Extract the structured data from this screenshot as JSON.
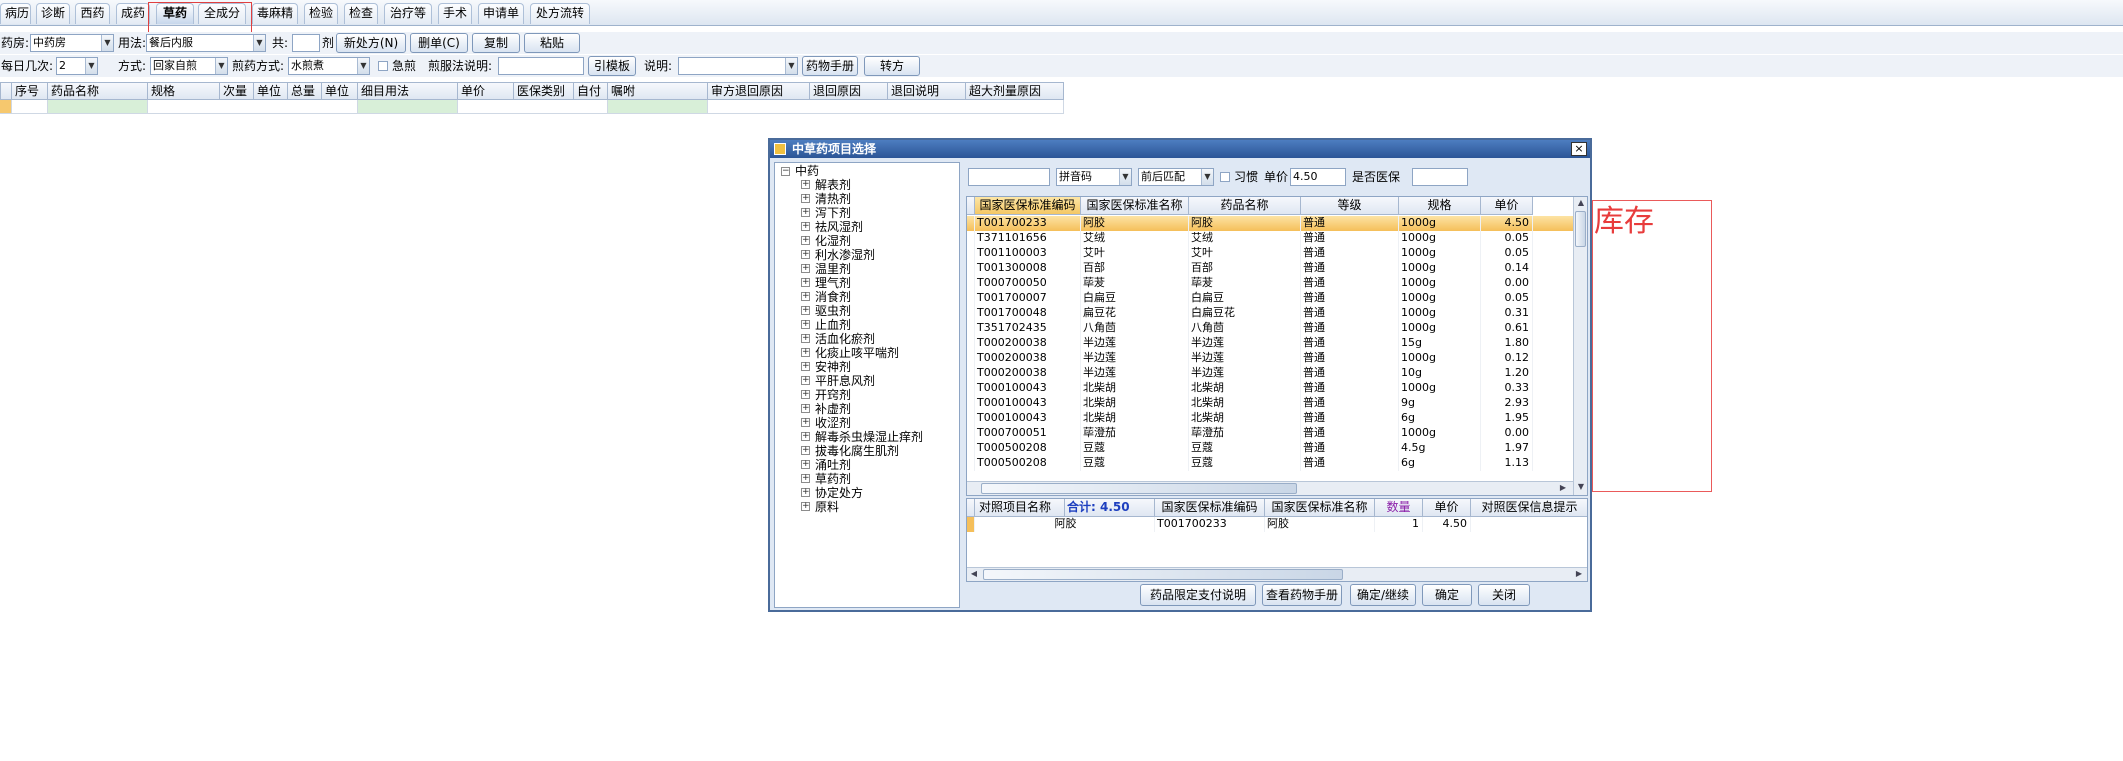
{
  "tabs": [
    {
      "label": "病历"
    },
    {
      "label": "诊断"
    },
    {
      "label": "西药"
    },
    {
      "label": "成药"
    },
    {
      "label": "草药"
    },
    {
      "label": "全成分"
    },
    {
      "label": "毒麻精"
    },
    {
      "label": "检验"
    },
    {
      "label": "检查"
    },
    {
      "label": "治疗等"
    },
    {
      "label": "手术"
    },
    {
      "label": "申请单"
    },
    {
      "label": "处方流转"
    }
  ],
  "toolbar": {
    "pharmacy_label": "药房:",
    "pharmacy_value": "中药房",
    "usage_label": "用法:",
    "usage_value": "餐后内服",
    "total_label": "共:",
    "total_value": "",
    "dose_unit": "剂",
    "new_rx": "新处方(N)",
    "delete_rx": "删单(C)",
    "copy": "复制",
    "paste": "粘贴",
    "times_label": "每日几次:",
    "times_value": "2",
    "method_label": "方式:",
    "method_value": "回家自煎",
    "decoct_label": "煎药方式:",
    "decoct_value": "水煎煮",
    "urgent_label": "急煎",
    "decoct_note_label": "煎服法说明:",
    "decoct_note_value": "",
    "template_btn": "引模板",
    "note_label": "说明:",
    "note_value": "",
    "manual_btn": "药物手册",
    "transfer_btn": "转方"
  },
  "main_grid": {
    "columns": [
      "序号",
      "药品名称",
      "规格",
      "次量",
      "单位",
      "总量",
      "单位",
      "细目用法",
      "单价",
      "医保类别",
      "自付",
      "嘱咐",
      "审方退回原因",
      "退回原因",
      "退回说明",
      "超大剂量原因"
    ]
  },
  "dialog": {
    "title": "中草药项目选择",
    "close": "×",
    "tree_root": "中药",
    "tree_items": [
      "解表剂",
      "清热剂",
      "泻下剂",
      "祛风湿剂",
      "化湿剂",
      "利水渗湿剂",
      "温里剂",
      "理气剂",
      "消食剂",
      "驱虫剂",
      "止血剂",
      "活血化瘀剂",
      "化痰止咳平喘剂",
      "安神剂",
      "平肝息风剂",
      "开窍剂",
      "补虚剂",
      "收涩剂",
      "解毒杀虫燥湿止痒剂",
      "拔毒化腐生肌剂",
      "涌吐剂",
      "草药剂",
      "协定处方",
      "原料"
    ],
    "search_value": "",
    "search_mode": "拼音码",
    "match_mode": "前后匹配",
    "habit_label": "习惯",
    "price_label": "单价",
    "price_value": "4.50",
    "insurance_label": "是否医保",
    "insurance_value": "",
    "columns": [
      "国家医保标准编码",
      "国家医保标准名称",
      "药品名称",
      "等级",
      "规格",
      "单价"
    ],
    "rows": [
      {
        "code": "T001700233",
        "std_name": "阿胶",
        "name": "阿胶",
        "level": "普通",
        "spec": "1000g",
        "price": "4.50"
      },
      {
        "code": "T371101656",
        "std_name": "艾绒",
        "name": "艾绒",
        "level": "普通",
        "spec": "1000g",
        "price": "0.05"
      },
      {
        "code": "T001100003",
        "std_name": "艾叶",
        "name": "艾叶",
        "level": "普通",
        "spec": "1000g",
        "price": "0.05"
      },
      {
        "code": "T001300008",
        "std_name": "百部",
        "name": "百部",
        "level": "普通",
        "spec": "1000g",
        "price": "0.14"
      },
      {
        "code": "T000700050",
        "std_name": "荜茇",
        "name": "荜茇",
        "level": "普通",
        "spec": "1000g",
        "price": "0.00"
      },
      {
        "code": "T001700007",
        "std_name": "白扁豆",
        "name": "白扁豆",
        "level": "普通",
        "spec": "1000g",
        "price": "0.05"
      },
      {
        "code": "T001700048",
        "std_name": "扁豆花",
        "name": "白扁豆花",
        "level": "普通",
        "spec": "1000g",
        "price": "0.31"
      },
      {
        "code": "T351702435",
        "std_name": "八角茴",
        "name": "八角茴",
        "level": "普通",
        "spec": "1000g",
        "price": "0.61"
      },
      {
        "code": "T000200038",
        "std_name": "半边莲",
        "name": "半边莲",
        "level": "普通",
        "spec": "15g",
        "price": "1.80"
      },
      {
        "code": "T000200038",
        "std_name": "半边莲",
        "name": "半边莲",
        "level": "普通",
        "spec": "1000g",
        "price": "0.12"
      },
      {
        "code": "T000200038",
        "std_name": "半边莲",
        "name": "半边莲",
        "level": "普通",
        "spec": "10g",
        "price": "1.20"
      },
      {
        "code": "T000100043",
        "std_name": "北柴胡",
        "name": "北柴胡",
        "level": "普通",
        "spec": "1000g",
        "price": "0.33"
      },
      {
        "code": "T000100043",
        "std_name": "北柴胡",
        "name": "北柴胡",
        "level": "普通",
        "spec": "9g",
        "price": "2.93"
      },
      {
        "code": "T000100043",
        "std_name": "北柴胡",
        "name": "北柴胡",
        "level": "普通",
        "spec": "6g",
        "price": "1.95"
      },
      {
        "code": "T000700051",
        "std_name": "荜澄茄",
        "name": "荜澄茄",
        "level": "普通",
        "spec": "1000g",
        "price": "0.00"
      },
      {
        "code": "T000500208",
        "std_name": "豆蔻",
        "name": "豆蔻",
        "level": "普通",
        "spec": "4.5g",
        "price": "1.97"
      },
      {
        "code": "T000500208",
        "std_name": "豆蔻",
        "name": "豆蔻",
        "level": "普通",
        "spec": "6g",
        "price": "1.13"
      }
    ],
    "bottom_columns": [
      "对照项目名称",
      "国家医保标准编码",
      "国家医保标准名称",
      "数量",
      "单价",
      "对照医保信息提示"
    ],
    "bottom_total": "合计: 4.50",
    "bottom_rows": [
      {
        "item": "阿胶",
        "code": "T001700233",
        "std_name": "阿胶",
        "qty": "1",
        "price": "4.50",
        "tip": ""
      }
    ],
    "buttons": {
      "restrict": "药品限定支付说明",
      "manual": "查看药物手册",
      "confirm_continue": "确定/继续",
      "confirm": "确定",
      "close": "关闭"
    }
  },
  "annotation": "库存",
  "colors": {
    "annotation_red": "#e83c3c",
    "dialog_title": "#2b5596",
    "selected_row": "#f5bf5a"
  }
}
